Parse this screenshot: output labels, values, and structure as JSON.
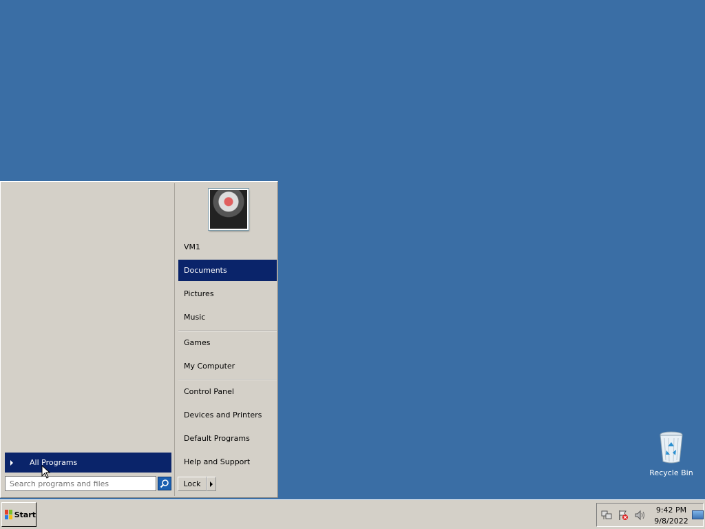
{
  "desktop": {
    "background_color": "#3a6ea5",
    "icons": [
      {
        "label": "Recycle Bin",
        "icon": "recycle-bin-icon"
      }
    ]
  },
  "start_menu": {
    "all_programs_label": "All Programs",
    "search_placeholder": "Search programs and files",
    "user_name": "VM1",
    "right_items": [
      {
        "label": "Documents",
        "selected": true
      },
      {
        "label": "Pictures"
      },
      {
        "label": "Music"
      },
      {
        "label": "Games"
      },
      {
        "label": "My Computer"
      },
      {
        "label": "Control Panel"
      },
      {
        "label": "Devices and Printers"
      },
      {
        "label": "Default Programs"
      },
      {
        "label": "Help and Support"
      }
    ],
    "lock_label": "Lock",
    "selection_color": "#0a246a"
  },
  "taskbar": {
    "start_label": "Start",
    "clock": {
      "time": "9:42 PM",
      "date": "9/8/2022"
    },
    "tray_icons": [
      "network-icon",
      "action-center-flag-icon",
      "volume-icon"
    ]
  }
}
